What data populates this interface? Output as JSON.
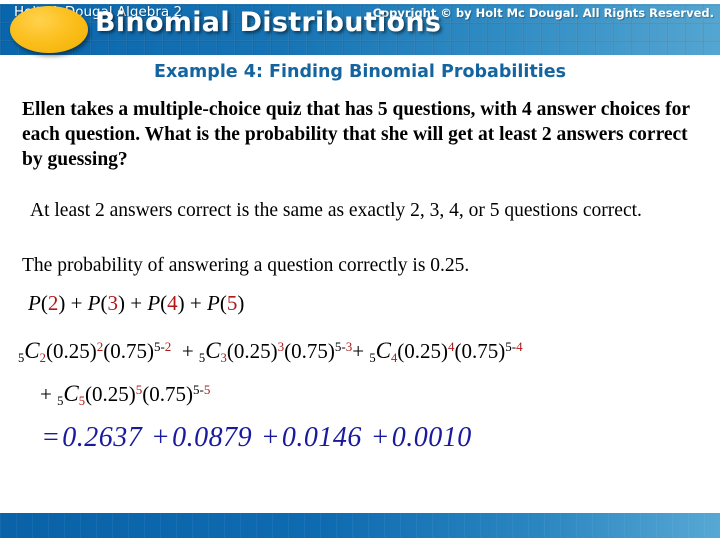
{
  "header": {
    "title": "Binomial Distributions",
    "accent_ellipse_color": "#fcc01f",
    "band_color_left": "#0a66ac",
    "band_color_right": "#54a6d2"
  },
  "subtitle": {
    "text": "Example 4: Finding Binomial Probabilities",
    "color": "#1464a0"
  },
  "body": {
    "problem": "Ellen takes a multiple-choice quiz that has 5 questions, with 4 answer choices for each question. What is the probability that she will get at least 2 answers correct by guessing?",
    "note": "At least 2 answers correct is the same as exactly 2, 3, 4, or 5 questions correct.",
    "probability_statement": "The probability of answering a question correctly is 0.25."
  },
  "math": {
    "sum_line": {
      "p": "P",
      "open": "(",
      "close": ")",
      "plus": "+",
      "terms": [
        "2",
        "3",
        "4",
        "5"
      ],
      "highlight_color": "#b01818"
    },
    "expansion": {
      "n": "5",
      "c": "C",
      "p_success": "0.25",
      "p_failure": "0.75",
      "plus": "+",
      "terms": [
        {
          "k": "2",
          "exp_success": "2",
          "exp_failure": "5-2"
        },
        {
          "k": "3",
          "exp_success": "3",
          "exp_failure": "5-3"
        },
        {
          "k": "4",
          "exp_success": "4",
          "exp_failure": "5-4"
        },
        {
          "k": "5",
          "exp_success": "5",
          "exp_failure": "5-5"
        }
      ]
    },
    "result": {
      "equals": "=",
      "plus": "+",
      "values": [
        "0.2637",
        "0.0879",
        "0.0146",
        "0.0010"
      ],
      "color": "#1a1a9c"
    }
  },
  "footer": {
    "left": "Holt McDougal Algebra 2",
    "right": "Copyright © by Holt Mc Dougal. All Rights Reserved."
  }
}
